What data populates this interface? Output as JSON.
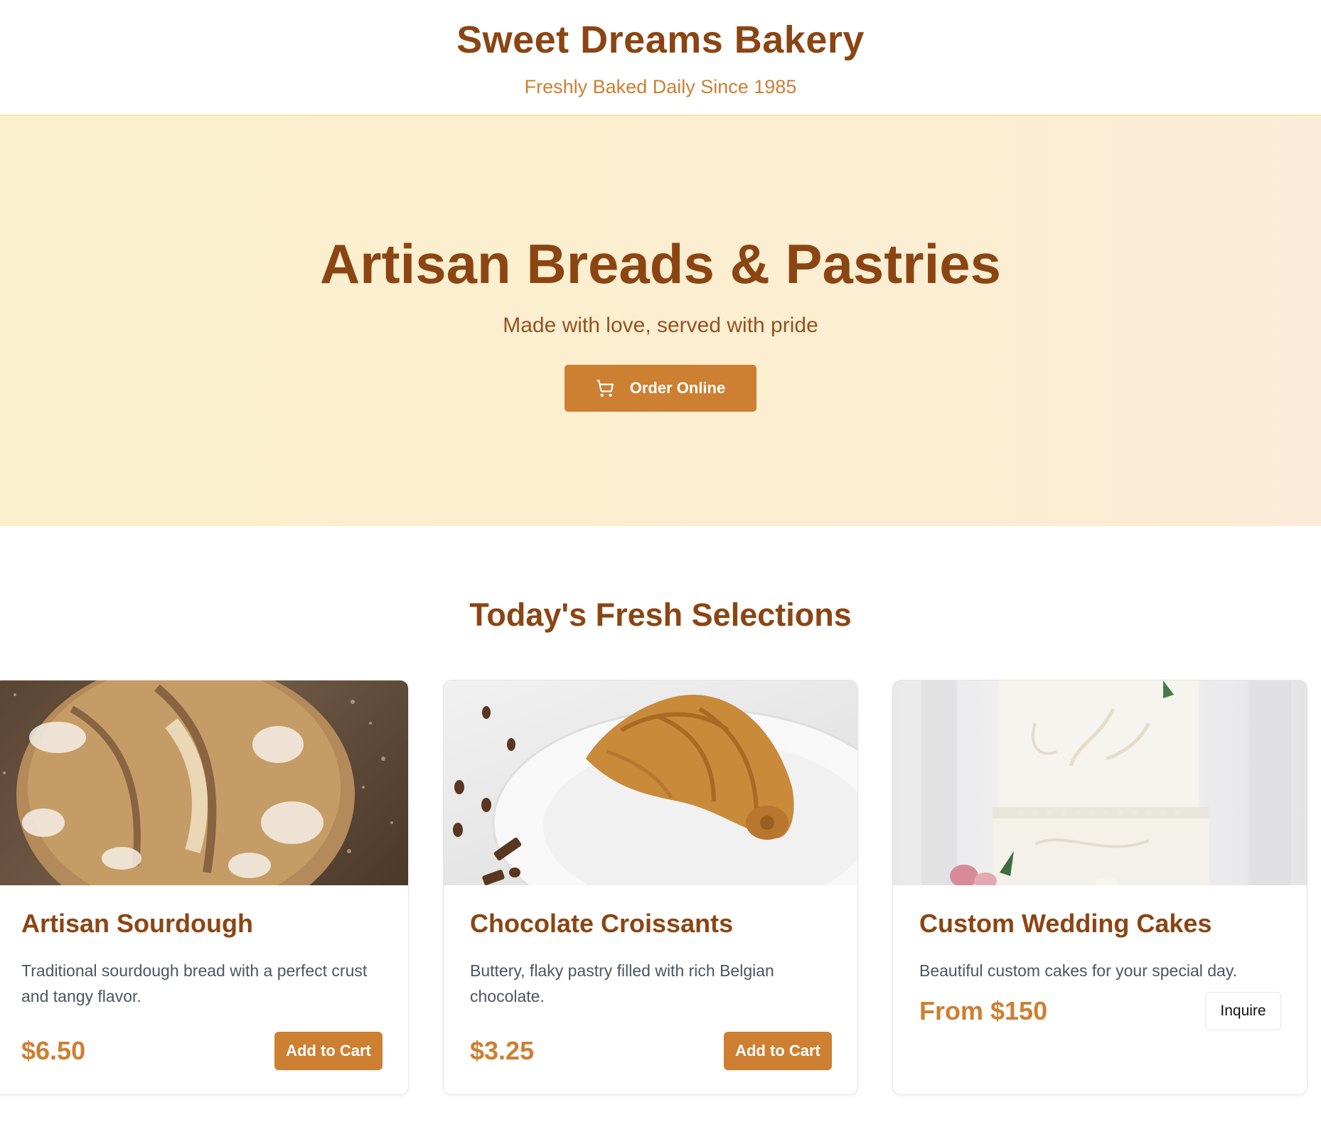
{
  "header": {
    "title": "Sweet Dreams Bakery",
    "tagline": "Freshly Baked Daily Since 1985"
  },
  "hero": {
    "title": "Artisan Breads & Pastries",
    "subtitle": "Made with love, served with pride",
    "order_button": {
      "label": "Order Online",
      "icon": "cart-icon"
    }
  },
  "selections": {
    "title": "Today's Fresh Selections",
    "products": [
      {
        "name": "Artisan Sourdough",
        "description": "Traditional sourdough bread with a perfect crust and tangy flavor.",
        "price": "$6.50",
        "action": "Add to Cart"
      },
      {
        "name": "Chocolate Croissants",
        "description": "Buttery, flaky pastry filled with rich Belgian chocolate.",
        "price": "$3.25",
        "action": "Add to Cart"
      },
      {
        "name": "Custom Wedding Cakes",
        "description": "Beautiful custom cakes for your special day.",
        "price": "From $150",
        "action": "Inquire"
      }
    ]
  },
  "colors": {
    "brand_brown": "#8B4513",
    "accent_orange": "#cd7f32",
    "hero_background": "#fbf0cd",
    "body_text": "#4b5563"
  }
}
